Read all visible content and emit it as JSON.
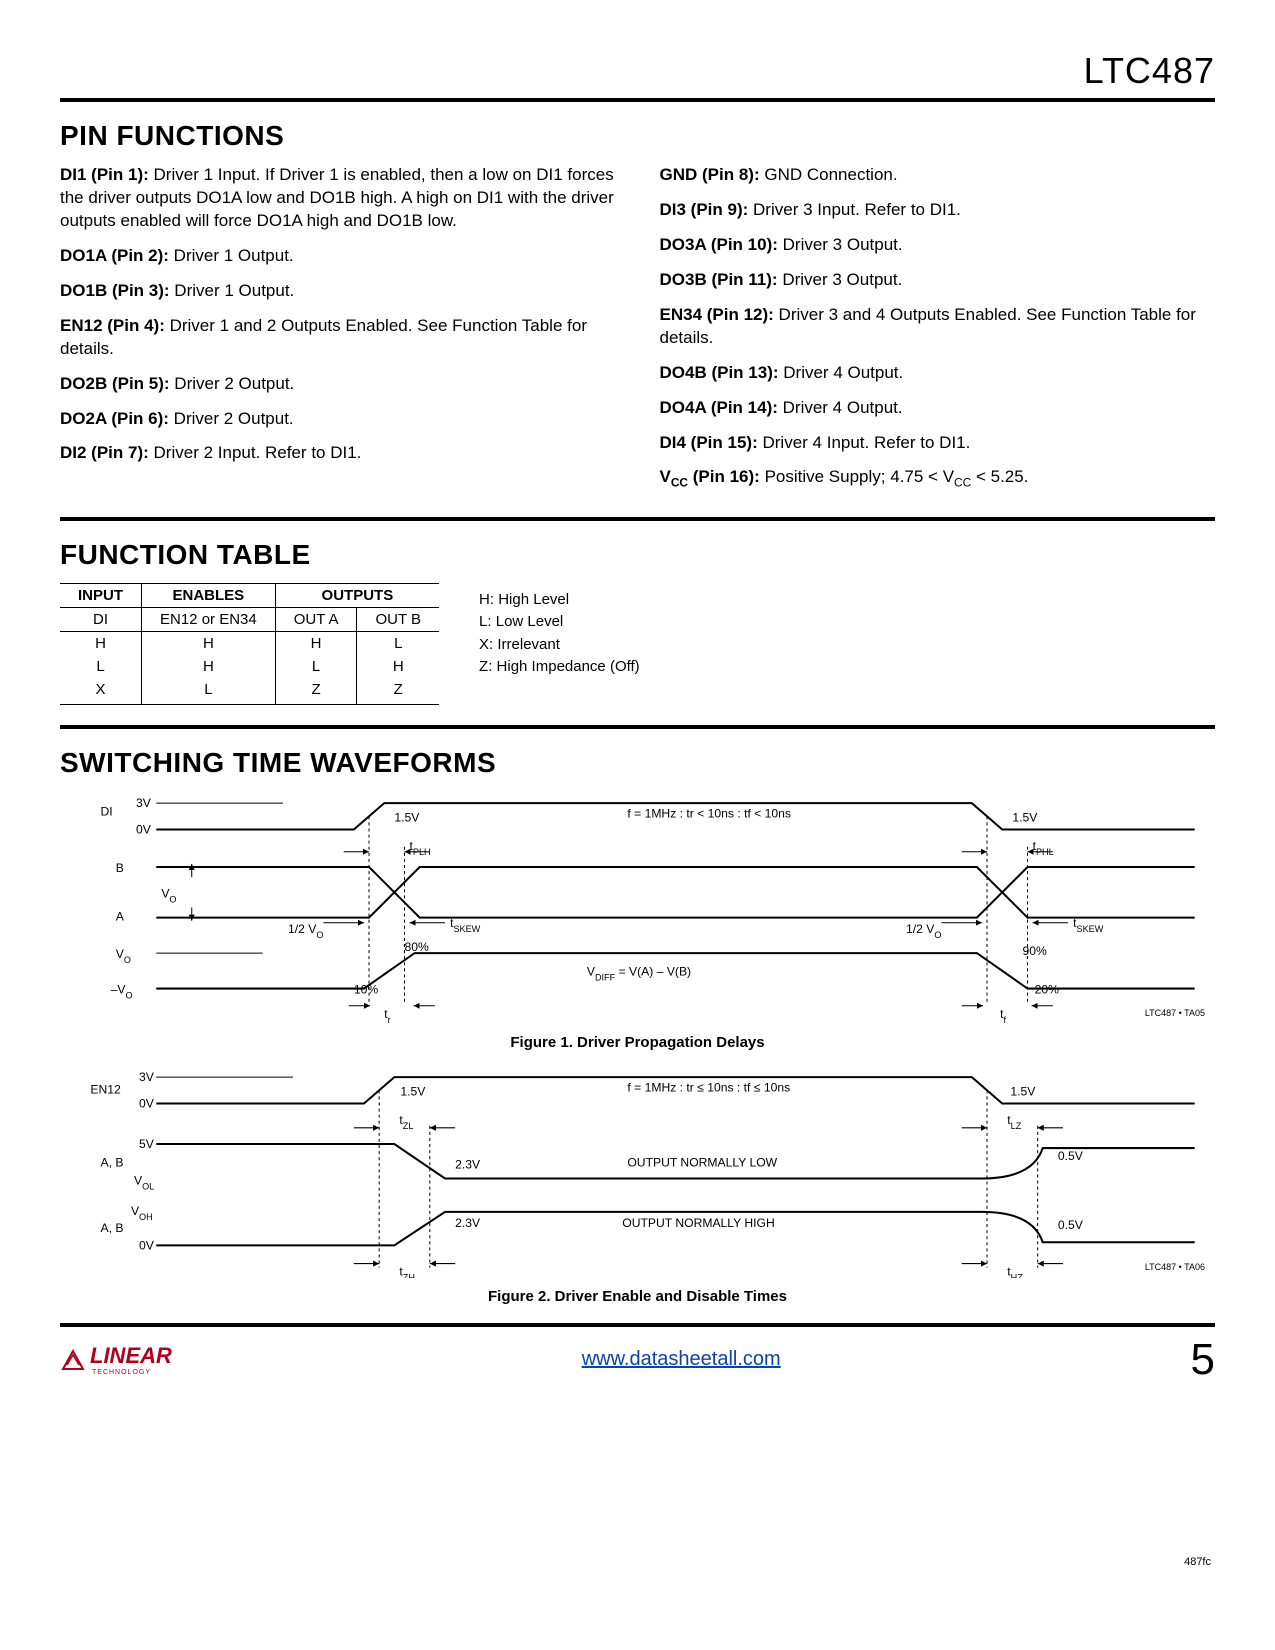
{
  "part": "LTC487",
  "rev": "487fc",
  "sections": {
    "pin_functions": "PIN FUNCTIONS",
    "function_table": "FUNCTION TABLE",
    "switching": "SWITCHING TIME WAVEFORMS"
  },
  "pins_left": [
    {
      "name": "DI1 (Pin 1):",
      "desc": "Driver 1 Input. If Driver 1 is enabled, then a low on DI1 forces the driver outputs DO1A low and DO1B high. A high on DI1 with the driver outputs enabled will force DO1A high and DO1B low."
    },
    {
      "name": "DO1A (Pin 2):",
      "desc": "Driver 1 Output."
    },
    {
      "name": "DO1B (Pin 3):",
      "desc": "Driver 1 Output."
    },
    {
      "name": "EN12 (Pin 4):",
      "desc": "Driver 1 and 2 Outputs Enabled. See Function Table for details."
    },
    {
      "name": "DO2B (Pin 5):",
      "desc": "Driver 2 Output."
    },
    {
      "name": "DO2A (Pin 6):",
      "desc": "Driver 2 Output."
    },
    {
      "name": "DI2 (Pin 7):",
      "desc": "Driver 2 Input. Refer to DI1."
    }
  ],
  "pins_right": [
    {
      "name": "GND (Pin 8):",
      "desc": "GND Connection."
    },
    {
      "name": "DI3 (Pin 9):",
      "desc": "Driver 3 Input. Refer to DI1."
    },
    {
      "name": "DO3A (Pin 10):",
      "desc": "Driver 3 Output."
    },
    {
      "name": "DO3B (Pin 11):",
      "desc": "Driver 3 Output."
    },
    {
      "name": "EN34 (Pin 12):",
      "desc": "Driver 3 and 4 Outputs Enabled. See Function Table for details."
    },
    {
      "name": "DO4B (Pin 13):",
      "desc": "Driver 4 Output."
    },
    {
      "name": "DO4A (Pin 14):",
      "desc": "Driver 4 Output."
    },
    {
      "name": "DI4 (Pin 15):",
      "desc": "Driver 4 Input. Refer to DI1."
    },
    {
      "name": "VCC (Pin 16):",
      "desc": "Positive Supply; 4.75 < VCC < 5.25."
    }
  ],
  "ft_headers": {
    "input": "INPUT",
    "enables": "ENABLES",
    "outputs": "OUTPUTS",
    "di": "DI",
    "en": "EN12 or EN34",
    "outa": "OUT A",
    "outb": "OUT B"
  },
  "ft_rows": [
    {
      "di": "H",
      "en": "H",
      "oa": "H",
      "ob": "L"
    },
    {
      "di": "L",
      "en": "H",
      "oa": "L",
      "ob": "H"
    },
    {
      "di": "X",
      "en": "L",
      "oa": "Z",
      "ob": "Z"
    }
  ],
  "legend": [
    "H: High Level",
    "L: Low Level",
    "X: Irrelevant",
    "Z: High Impedance (Off)"
  ],
  "fig1": {
    "caption": "Figure 1. Driver Propagation Delays",
    "note": "LTC487 • TA05",
    "labels": {
      "di": "DI",
      "3v": "3V",
      "0v": "0V",
      "b": "B",
      "a": "A",
      "vo": "VO",
      "mvo": "–VO",
      "1p5": "1.5V",
      "tplh": "tPLH",
      "tphl": "tPHL",
      "half": "1/2 VO",
      "tskew": "tSKEW",
      "80": "80%",
      "90": "90%",
      "10": "10%",
      "20": "20%",
      "tr": "tr",
      "tf": "tf",
      "vdiff": "VDIFF = V(A) – V(B)",
      "cond": "f = 1MHz : tr < 10ns : tf < 10ns"
    }
  },
  "fig2": {
    "caption": "Figure 2. Driver Enable and Disable Times",
    "note": "LTC487 • TA06",
    "labels": {
      "en12": "EN12",
      "3v": "3V",
      "0v": "0V",
      "ab": "A, B",
      "5v": "5V",
      "vol": "VOL",
      "voh": "VOH",
      "0v2": "0V",
      "1p5": "1.5V",
      "2p3": "2.3V",
      "0p5": "0.5V",
      "tzl": "tZL",
      "tlz": "tLZ",
      "tzh": "tZH",
      "thz": "tHZ",
      "low": "OUTPUT NORMALLY LOW",
      "high": "OUTPUT NORMALLY HIGH",
      "cond": "f = 1MHz : tr ≤ 10ns : tf ≤ 10ns"
    }
  },
  "footer": {
    "logo": "LINEAR",
    "logo_sub": "TECHNOLOGY",
    "url": "www.datasheetall.com",
    "page": "5"
  }
}
